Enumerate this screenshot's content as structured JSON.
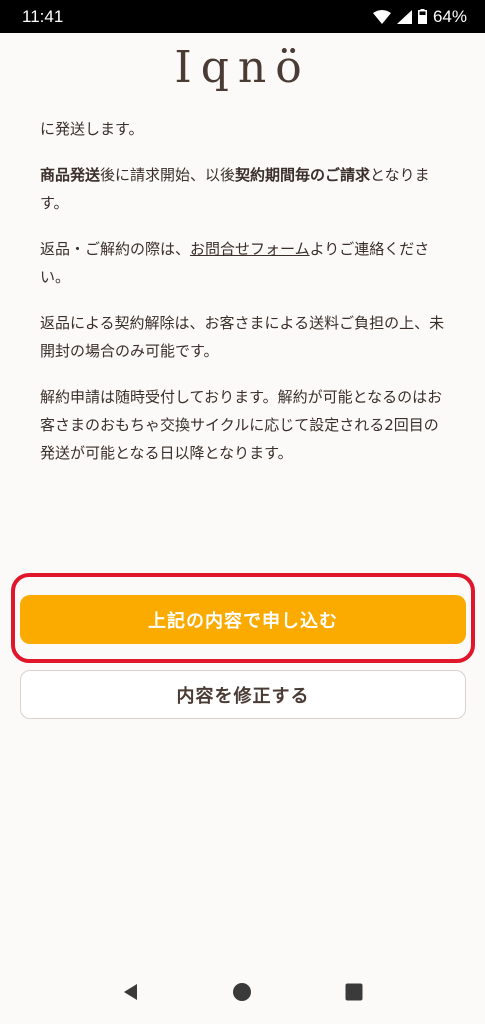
{
  "status_bar": {
    "time": "11:41",
    "battery": "64%",
    "icons": [
      "wifi-icon",
      "signal-icon",
      "battery-icon"
    ]
  },
  "brand": {
    "logo": "Iqnö"
  },
  "content": {
    "p1": "に発送します。",
    "p2": {
      "b1": "商品発送",
      "t1": "後に請求開始、以後",
      "b2": "契約期間毎のご請求",
      "t2": "となります。"
    },
    "p3": {
      "t1": "返品・ご解約の際は、",
      "link": "お問合せフォーム",
      "t2": "よりご連絡ください。"
    },
    "p4": "返品による契約解除は、お客さまによる送料ご負担の上、未開封の場合のみ可能です。",
    "p5": "解約申請は随時受付しております。解約が可能となるのはお客さまのおもちゃ交換サイクルに応じて設定される2回目の発送が可能となる日以降となります。"
  },
  "actions": {
    "submit_label": "上記の内容で申し込む",
    "edit_label": "内容を修正する"
  },
  "nav": {
    "icons": [
      "back-icon",
      "home-icon",
      "recents-icon"
    ]
  },
  "colors": {
    "primary": "#fbaa00",
    "highlight": "#e0162b",
    "background": "#fcfaf8",
    "text": "#3a2f2a"
  }
}
